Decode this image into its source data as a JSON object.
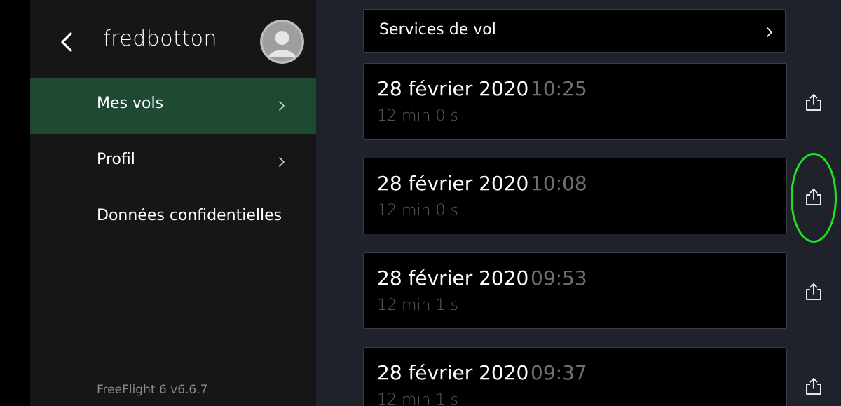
{
  "header": {
    "username": "fredbotton",
    "back_icon": "chevron-left-icon",
    "avatar_icon": "user-avatar-icon"
  },
  "sidebar": {
    "items": [
      {
        "label": "Mes vols",
        "active": true,
        "chevron": true
      },
      {
        "label": "Profil",
        "active": false,
        "chevron": true
      },
      {
        "label": "Données confidentielles",
        "active": false,
        "chevron": false
      }
    ],
    "version": "FreeFlight 6 v6.6.7"
  },
  "services": {
    "label": "Services de vol"
  },
  "flights": [
    {
      "date": "28 février 2020",
      "time": "10:25",
      "duration": "12 min 0 s"
    },
    {
      "date": "28 février 2020",
      "time": "10:08",
      "duration": "12 min 0 s"
    },
    {
      "date": "28 février 2020",
      "time": "09:53",
      "duration": "12 min 1 s"
    },
    {
      "date": "28 février 2020",
      "time": "09:37",
      "duration": "12 min 1 s"
    }
  ],
  "colors": {
    "active_item": "#1e4a34",
    "sidebar_bg": "#161616",
    "content_bg": "#1f222b",
    "highlight": "#22e022"
  }
}
